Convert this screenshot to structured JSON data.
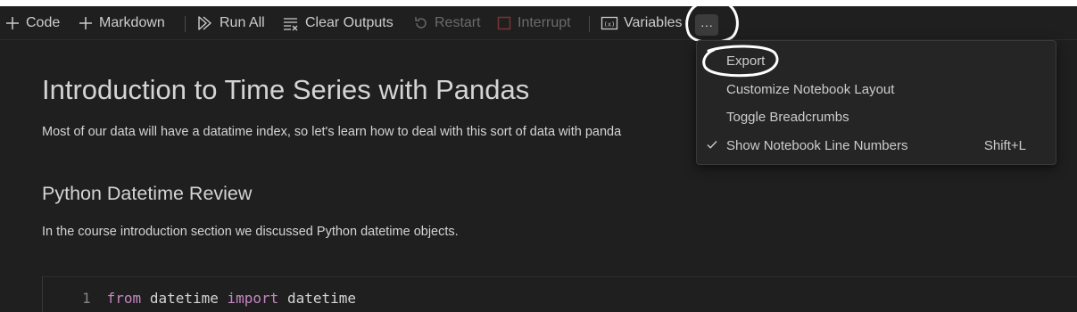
{
  "toolbar": {
    "code_label": "Code",
    "markdown_label": "Markdown",
    "run_all_label": "Run All",
    "clear_outputs_label": "Clear Outputs",
    "restart_label": "Restart",
    "interrupt_label": "Interrupt",
    "variables_label": "Variables",
    "more_label": "···",
    "icons": [
      "plus-icon",
      "plus-icon",
      "run-all-icon",
      "clear-outputs-icon",
      "restart-icon",
      "interrupt-icon",
      "variables-icon",
      "more-actions-icon"
    ]
  },
  "menu": {
    "items": [
      {
        "label": "Export",
        "shortcut": "",
        "checked": false
      },
      {
        "label": "Customize Notebook Layout",
        "shortcut": "",
        "checked": false
      },
      {
        "label": "Toggle Breadcrumbs",
        "shortcut": "",
        "checked": false
      },
      {
        "label": "Show Notebook Line Numbers",
        "shortcut": "Shift+L",
        "checked": true
      }
    ]
  },
  "notebook": {
    "heading1": "Introduction to Time Series with Pandas",
    "paragraph1": "Most of our data will have a datatime index, so let's learn how to deal with this sort of data with panda",
    "heading2": "Python Datetime Review",
    "paragraph2": "In the course introduction section we discussed Python datetime objects.",
    "code_line_number": "1",
    "code_kw_from": "from",
    "code_module": "datetime",
    "code_kw_import": "import",
    "code_name": "datetime"
  },
  "colors": {
    "background": "#1f1f1f",
    "menu_background": "#252526",
    "text": "#cccccc",
    "disabled_text": "#6b6b6b",
    "keyword": "#c586c0"
  }
}
